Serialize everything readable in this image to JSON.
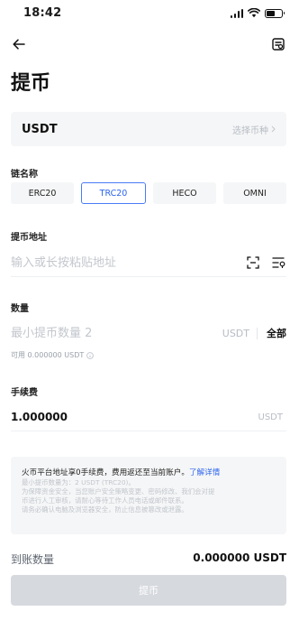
{
  "status_bar": {
    "time": "18:42"
  },
  "page": {
    "title": "提币"
  },
  "coin": {
    "name": "USDT",
    "select_hint": "选择币种"
  },
  "chain": {
    "label": "链名称",
    "options": [
      "ERC20",
      "TRC20",
      "HECO",
      "OMNI"
    ],
    "selected": "TRC20"
  },
  "address": {
    "label": "提币地址",
    "placeholder": "输入或长按粘贴地址"
  },
  "amount": {
    "label": "数量",
    "placeholder": "最小提币数量 2",
    "unit": "USDT",
    "all_label": "全部",
    "available": "可用 0.000000 USDT"
  },
  "fee": {
    "label": "手续费",
    "value": "1.000000",
    "unit": "USDT"
  },
  "notice": {
    "title": "火币平台地址享0手续费，费用返还至当前账户。",
    "link": "了解详情",
    "lines": [
      "最小提币数量为：2 USDT (TRC20)。",
      "为保障资金安全，当您账户安全策略变更、密码修改、我们会对提",
      "币进行人工审核，请耐心等待工作人员电话或邮件联系。",
      "请务必确认电脑及浏览器安全，防止信息被篡改或泄露。"
    ]
  },
  "receive": {
    "label": "到账数量",
    "value": "0.000000 USDT"
  },
  "submit": {
    "label": "提币"
  },
  "colors": {
    "accent": "#2c64f0",
    "disabled_button": "#d6d9de",
    "panel": "#f5f6f7"
  },
  "icons": [
    "back-arrow-icon",
    "withdraw-record-icon",
    "chevron-right-icon",
    "scan-icon",
    "address-book-icon",
    "info-icon"
  ]
}
